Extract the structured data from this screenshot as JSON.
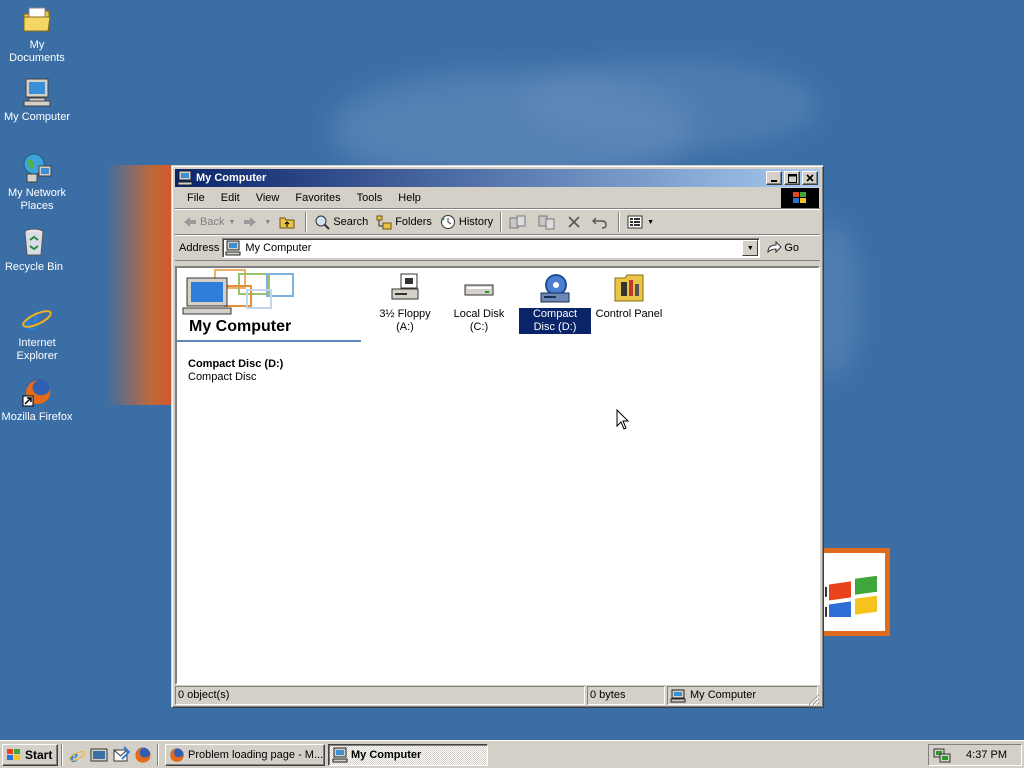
{
  "desktop": {
    "icons": [
      {
        "label": "My Documents",
        "icon": "my-documents-icon"
      },
      {
        "label": "My Computer",
        "icon": "my-computer-icon"
      },
      {
        "label": "My Network Places",
        "icon": "network-places-icon"
      },
      {
        "label": "Recycle Bin",
        "icon": "recycle-bin-icon"
      },
      {
        "label": "Internet Explorer",
        "icon": "internet-explorer-icon"
      },
      {
        "label": "Mozilla Firefox",
        "icon": "firefox-icon"
      }
    ],
    "background_color": "#3a6ea5"
  },
  "window": {
    "title": "My Computer",
    "menu": [
      "File",
      "Edit",
      "View",
      "Favorites",
      "Tools",
      "Help"
    ],
    "toolbar": {
      "back": "Back",
      "search": "Search",
      "folders": "Folders",
      "history": "History"
    },
    "address": {
      "label": "Address",
      "value": "My Computer",
      "go": "Go"
    },
    "webview": {
      "title": "My Computer",
      "selected_name": "Compact Disc (D:)",
      "selected_desc": "Compact Disc"
    },
    "items": [
      {
        "label": "3½ Floppy (A:)",
        "icon": "floppy-drive-icon",
        "selected": false
      },
      {
        "label": "Local Disk (C:)",
        "icon": "hard-disk-icon",
        "selected": false
      },
      {
        "label": "Compact Disc (D:)",
        "icon": "cd-drive-icon",
        "selected": true
      },
      {
        "label": "Control Panel",
        "icon": "control-panel-icon",
        "selected": false
      }
    ],
    "status": {
      "objects": "0 object(s)",
      "size": "0 bytes",
      "zone": "My Computer"
    }
  },
  "taskbar": {
    "start": "Start",
    "tasks": [
      {
        "label": "Problem loading page - M...",
        "active": false
      },
      {
        "label": "My Computer",
        "active": true
      }
    ],
    "clock": "4:37 PM"
  },
  "colors": {
    "title_active": "#0a246a",
    "title_gradient_end": "#a6caf0",
    "selection": "#0a246a",
    "face": "#d4d0c8"
  }
}
